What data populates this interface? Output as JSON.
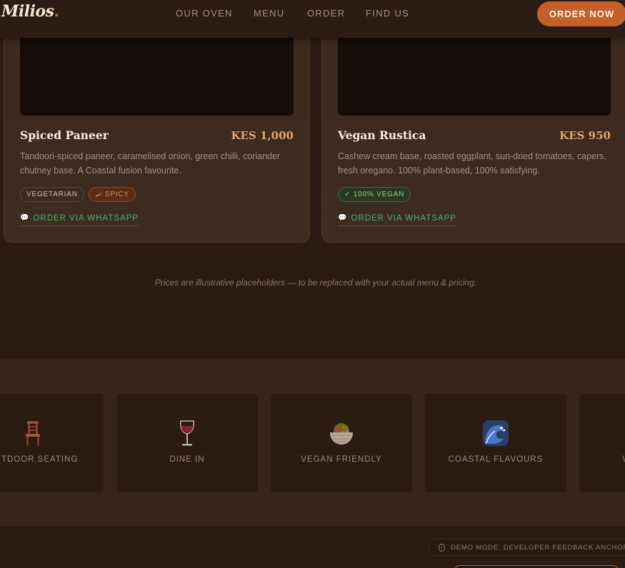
{
  "brand": {
    "logo_text": "Milios",
    "logo_dot": ".",
    "accent_color": "#c4602a"
  },
  "nav": {
    "items": [
      "OUR OVEN",
      "MENU",
      "ORDER",
      "FIND US"
    ],
    "cta_label": "ORDER NOW"
  },
  "menu": {
    "cards": [
      {
        "title": "Spiced Paneer",
        "price": "KES 1,000",
        "description": "Tandoori-spiced paneer, caramelised onion, green chilli, coriander chutney base. A Coastal fusion favourite.",
        "tags": [
          "VEGETARIAN",
          "SPICY"
        ],
        "order_label": "ORDER VIA WHATSAPP"
      },
      {
        "title": "Vegan Rustica",
        "price": "KES 950",
        "description": "Cashew cream base, roasted eggplant, sun-dried tomatoes, capers, fresh oregano. 100% plant-based, 100% satisfying.",
        "tags": [
          "✓ 100% VEGAN"
        ],
        "order_label": "ORDER VIA WHATSAPP"
      }
    ],
    "price_note": "Prices are illustrative placeholders — to be replaced with your actual menu & pricing."
  },
  "features": [
    {
      "label": "OUTDOOR SEATING",
      "icon": "chair-icon"
    },
    {
      "label": "DINE IN",
      "icon": "wine-glass-icon"
    },
    {
      "label": "VEGAN FRIENDLY",
      "icon": "salad-bowl-icon"
    },
    {
      "label": "COASTAL FLAVOURS",
      "icon": "wave-icon"
    },
    {
      "label": "V",
      "icon": ""
    }
  ],
  "demo_badge": {
    "label": "DEMO MODE: DEVELOPER FEEDBACK ANCHOR",
    "icon": "info-icon"
  }
}
